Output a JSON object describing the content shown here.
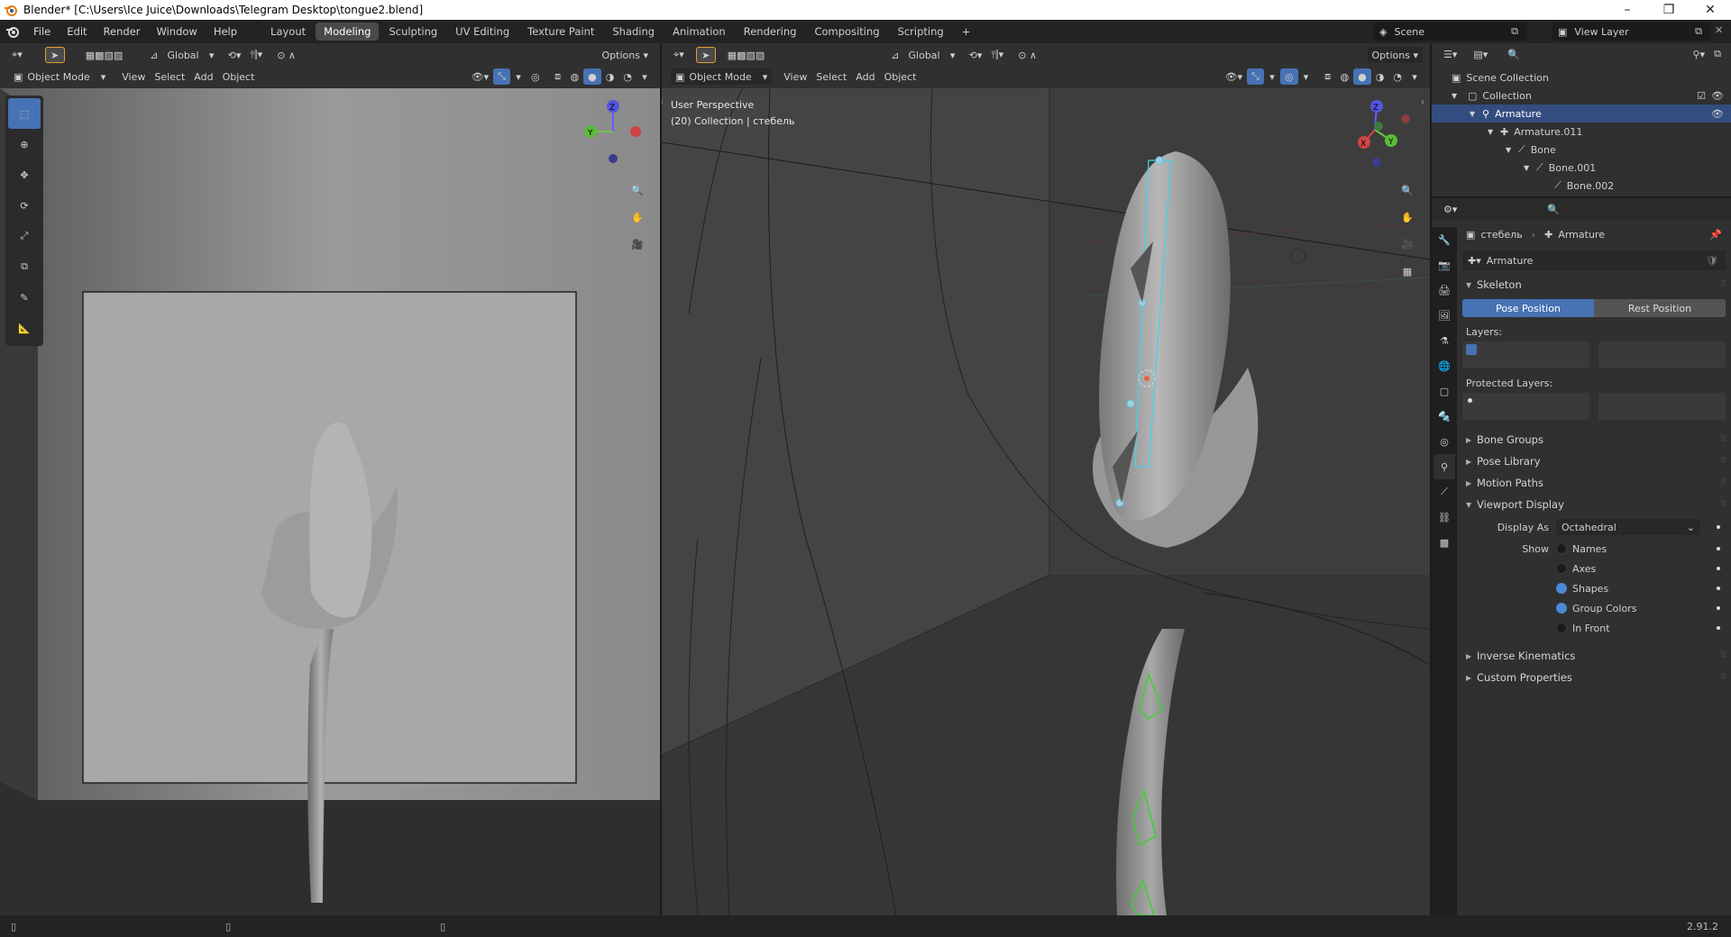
{
  "window": {
    "title": "Blender* [C:\\Users\\Ice Juice\\Downloads\\Telegram Desktop\\tongue2.blend]",
    "minimize": "–",
    "maximize": "❐",
    "close": "✕"
  },
  "menu": [
    "File",
    "Edit",
    "Render",
    "Window",
    "Help"
  ],
  "workspaces": [
    "Layout",
    "Modeling",
    "Sculpting",
    "UV Editing",
    "Texture Paint",
    "Shading",
    "Animation",
    "Rendering",
    "Compositing",
    "Scripting"
  ],
  "workspace_active": "Modeling",
  "add_workspace": "+",
  "scene": {
    "label": "Scene",
    "view_layer": "View Layer"
  },
  "left_viewport": {
    "orientation": "Global",
    "options": "Options",
    "mode": "Object Mode",
    "menus": [
      "View",
      "Select",
      "Add",
      "Object"
    ],
    "gizmo": {
      "x": "",
      "y": "Y",
      "z": "Z"
    }
  },
  "right_viewport": {
    "orientation": "Global",
    "options": "Options",
    "mode": "Object Mode",
    "menus": [
      "View",
      "Select",
      "Add",
      "Object"
    ],
    "info_line1": "User Perspective",
    "info_line2": "(20) Collection | стебель",
    "gizmo": {
      "x": "X",
      "y": "Y",
      "z": "Z"
    }
  },
  "outliner": {
    "rows": [
      {
        "label": "Scene Collection",
        "level": 0,
        "icon": "scene-collection-icon"
      },
      {
        "label": "Collection",
        "level": 1,
        "icon": "collection-icon"
      },
      {
        "label": "Armature",
        "level": 2,
        "icon": "armature-icon",
        "selected": true
      },
      {
        "label": "Armature.011",
        "level": 3,
        "icon": "armature-data-icon"
      },
      {
        "label": "Bone",
        "level": 4,
        "icon": "bone-icon"
      },
      {
        "label": "Bone.001",
        "level": 5,
        "icon": "bone-icon"
      },
      {
        "label": "Bone.002",
        "level": 6,
        "icon": "bone-icon"
      }
    ]
  },
  "properties": {
    "breadcrumb_object": "стебель",
    "breadcrumb_sep": "›",
    "breadcrumb_data": "Armature",
    "datablock_name": "Armature",
    "skeleton_label": "Skeleton",
    "pose_position": "Pose Position",
    "rest_position": "Rest Position",
    "layers_label": "Layers:",
    "protected_layers_label": "Protected Layers:",
    "collapsed_sections": [
      "Bone Groups",
      "Pose Library",
      "Motion Paths"
    ],
    "viewport_display_label": "Viewport Display",
    "display_as_label": "Display As",
    "display_as_value": "Octahedral",
    "show_label": "Show",
    "show_options": [
      {
        "label": "Names",
        "checked": false
      },
      {
        "label": "Axes",
        "checked": false
      },
      {
        "label": "Shapes",
        "checked": true
      },
      {
        "label": "Group Colors",
        "checked": true
      },
      {
        "label": "In Front",
        "checked": false
      }
    ],
    "bottom_sections": [
      "Inverse Kinematics",
      "Custom Properties"
    ]
  },
  "status": {
    "version": "2.91.2"
  },
  "colors": {
    "accent": "#4772b3",
    "selected_row": "#334d80",
    "bone_cyan": "#3fd3f0",
    "bone_green": "#3bd12f"
  }
}
